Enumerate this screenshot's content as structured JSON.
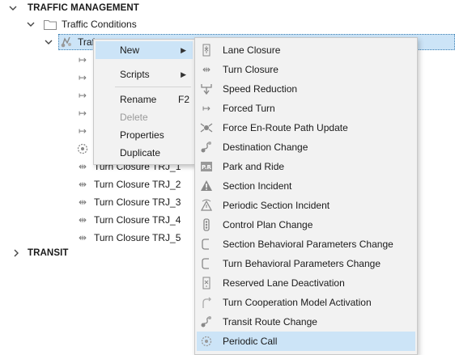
{
  "tree": {
    "traffic_management": "TRAFFIC MANAGEMENT",
    "traffic_conditions": "Traffic Conditions",
    "selected_item_partial": "Traf",
    "turn_closure_items": [
      "Turn Closure TRJ_1",
      "Turn Closure TRJ_2",
      "Turn Closure TRJ_3",
      "Turn Closure TRJ_4",
      "Turn Closure TRJ_5"
    ],
    "transit": "TRANSIT"
  },
  "context_menu": {
    "new": "New",
    "scripts": "Scripts",
    "rename": "Rename",
    "rename_shortcut": "F2",
    "delete": "Delete",
    "properties": "Properties",
    "duplicate": "Duplicate"
  },
  "submenu": {
    "items": [
      {
        "label": "Lane Closure",
        "icon": "lane-closure-icon"
      },
      {
        "label": "Turn Closure",
        "icon": "turn-closure-icon"
      },
      {
        "label": "Speed Reduction",
        "icon": "speed-reduction-icon"
      },
      {
        "label": "Forced Turn",
        "icon": "forced-turn-icon"
      },
      {
        "label": "Force En-Route Path Update",
        "icon": "path-update-icon"
      },
      {
        "label": "Destination Change",
        "icon": "destination-change-icon"
      },
      {
        "label": "Park and Ride",
        "icon": "park-and-ride-icon"
      },
      {
        "label": "Section Incident",
        "icon": "warning-icon"
      },
      {
        "label": "Periodic Section Incident",
        "icon": "periodic-warning-icon"
      },
      {
        "label": "Control Plan Change",
        "icon": "traffic-light-icon"
      },
      {
        "label": "Section Behavioral Parameters Change",
        "icon": "section-bracket-icon"
      },
      {
        "label": "Turn Behavioral Parameters Change",
        "icon": "turn-bracket-icon"
      },
      {
        "label": "Reserved Lane Deactivation",
        "icon": "reserved-lane-icon"
      },
      {
        "label": "Turn Cooperation Model Activation",
        "icon": "turn-cooperation-icon"
      },
      {
        "label": "Transit Route Change",
        "icon": "route-change-icon"
      },
      {
        "label": "Periodic Call",
        "icon": "periodic-call-icon"
      }
    ]
  },
  "colors": {
    "highlight": "#cce4f7",
    "menu_bg": "#f2f2f2",
    "disabled_text": "#9a9a9a"
  }
}
